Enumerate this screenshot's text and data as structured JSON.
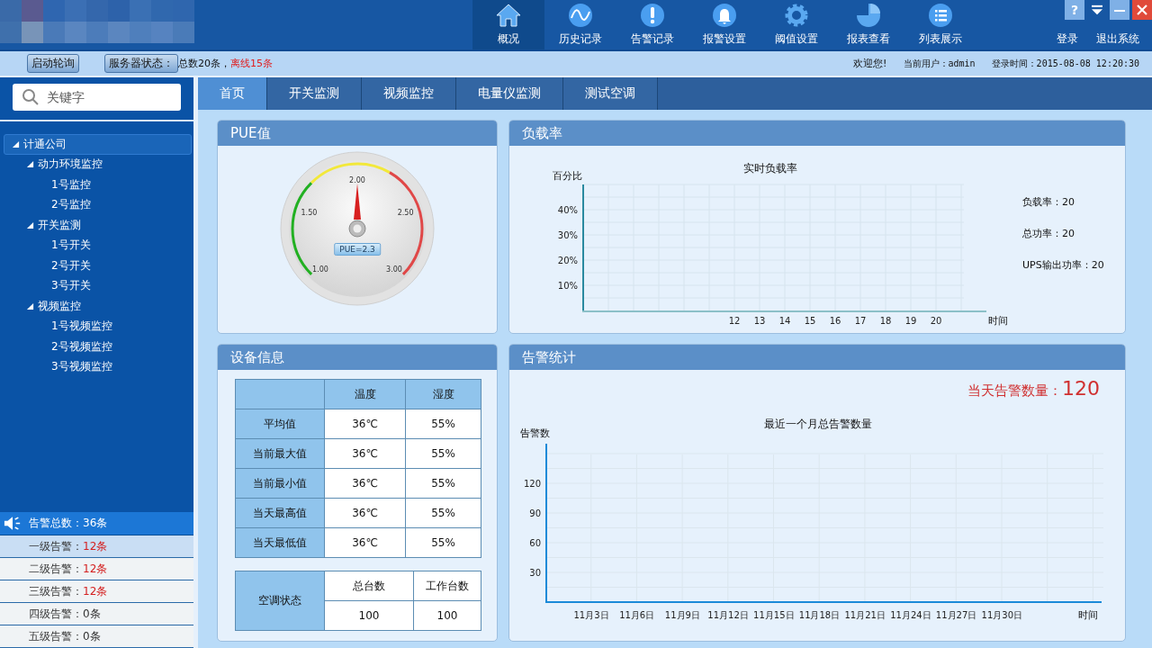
{
  "nav": [
    {
      "label": "概况",
      "kind": "home",
      "selected": true
    },
    {
      "label": "历史记录",
      "kind": "wave",
      "selected": false
    },
    {
      "label": "告警记录",
      "kind": "alert",
      "selected": false
    },
    {
      "label": "报警设置",
      "kind": "bell",
      "selected": false
    },
    {
      "label": "阈值设置",
      "kind": "gear",
      "selected": false
    },
    {
      "label": "报表查看",
      "kind": "pie",
      "selected": false
    },
    {
      "label": "列表展示",
      "kind": "list",
      "selected": false
    }
  ],
  "help_button": "?",
  "top_links": [
    "登录",
    "退出系统"
  ],
  "status_bar": {
    "poll_button": "启动轮询",
    "server_button": "服务器状态：",
    "total": "总数20条，",
    "offline": "离线15条",
    "welcome": "欢迎您!",
    "user": "当前用户：admin",
    "login_time": "登录时间：2015-08-08 12:20:30"
  },
  "search": {
    "placeholder": "关键字"
  },
  "tree": [
    {
      "label": "计通公司",
      "expanded": true,
      "selected": true,
      "children": [
        {
          "label": "动力环境监控",
          "expanded": true,
          "selected": false,
          "children": [
            {
              "label": "1号监控",
              "selected": false
            },
            {
              "label": "2号监控",
              "selected": false
            }
          ]
        },
        {
          "label": "开关监测",
          "expanded": true,
          "selected": false,
          "children": [
            {
              "label": "1号开关",
              "selected": false
            },
            {
              "label": "2号开关",
              "selected": false
            },
            {
              "label": "3号开关",
              "selected": false
            }
          ]
        },
        {
          "label": "视频监控",
          "expanded": true,
          "selected": false,
          "children": [
            {
              "label": "1号视频监控",
              "selected": false
            },
            {
              "label": "2号视频监控",
              "selected": false
            },
            {
              "label": "3号视频监控",
              "selected": false
            }
          ]
        }
      ]
    }
  ],
  "alarm_total": "告警总数：36条",
  "alarm_levels": [
    {
      "label": "一级告警：",
      "count": "12条",
      "alert": true,
      "selected": true
    },
    {
      "label": "二级告警：",
      "count": "12条",
      "alert": true,
      "selected": false
    },
    {
      "label": "三级告警：",
      "count": "12条",
      "alert": true,
      "selected": false
    },
    {
      "label": "四级告警：",
      "count": "0条",
      "alert": false,
      "selected": false
    },
    {
      "label": "五级告警：",
      "count": "0条",
      "alert": false,
      "selected": false
    }
  ],
  "tabs": [
    {
      "label": "首页",
      "selected": true
    },
    {
      "label": "开关监测",
      "selected": false
    },
    {
      "label": "视频监控",
      "selected": false
    },
    {
      "label": "电量仪监测",
      "selected": false
    },
    {
      "label": "测试空调",
      "selected": false
    }
  ],
  "pue": {
    "title": "PUE值",
    "scale": [
      "1.00",
      "1.50",
      "2.00",
      "2.50",
      "3.00"
    ],
    "reading": "PUE=2.3"
  },
  "load": {
    "title": "负载率",
    "chart_data": {
      "type": "line",
      "title": "实时负载率",
      "ylabel": "百分比",
      "xlabel": "时间",
      "grid": true,
      "xlim": [
        6,
        22
      ],
      "ylim": [
        0,
        50
      ],
      "xticks": [
        12,
        13,
        14,
        15,
        16,
        17,
        18,
        19,
        20
      ],
      "yticks": [
        {
          "value": 10,
          "label": "10%"
        },
        {
          "value": 20,
          "label": "20%"
        },
        {
          "value": 30,
          "label": "30%"
        },
        {
          "value": 40,
          "label": "40%"
        }
      ]
    },
    "readings": [
      "负载率：20",
      "总功率：20",
      "UPS输出功率：20"
    ]
  },
  "device": {
    "title": "设备信息",
    "columns": [
      "温度",
      "湿度"
    ],
    "rows": [
      {
        "name": "平均值",
        "temperature": "36℃",
        "humidity": "55%"
      },
      {
        "name": "当前最大值",
        "temperature": "36℃",
        "humidity": "55%"
      },
      {
        "name": "当前最小值",
        "temperature": "36℃",
        "humidity": "55%"
      },
      {
        "name": "当天最高值",
        "temperature": "36℃",
        "humidity": "55%"
      },
      {
        "name": "当天最低值",
        "temperature": "36℃",
        "humidity": "55%"
      }
    ],
    "ac": {
      "label": "空调状态",
      "columns": [
        "总台数",
        "工作台数"
      ],
      "values": [
        "100",
        "100"
      ]
    }
  },
  "alarms": {
    "title": "告警统计",
    "today_label": "当天告警数量：",
    "today_count": "120",
    "chart_data": {
      "type": "line",
      "title": "最近一个月总告警数量",
      "ylabel": "告警数",
      "xlabel": "时间",
      "grid": true,
      "ylim": [
        0,
        160
      ],
      "categories": [
        "11月3日",
        "11月6日",
        "11月9日",
        "11月12日",
        "11月15日",
        "11月18日",
        "11月21日",
        "11月24日",
        "11月27日",
        "11月30日"
      ],
      "yticks": [
        30,
        60,
        90,
        120
      ]
    }
  }
}
